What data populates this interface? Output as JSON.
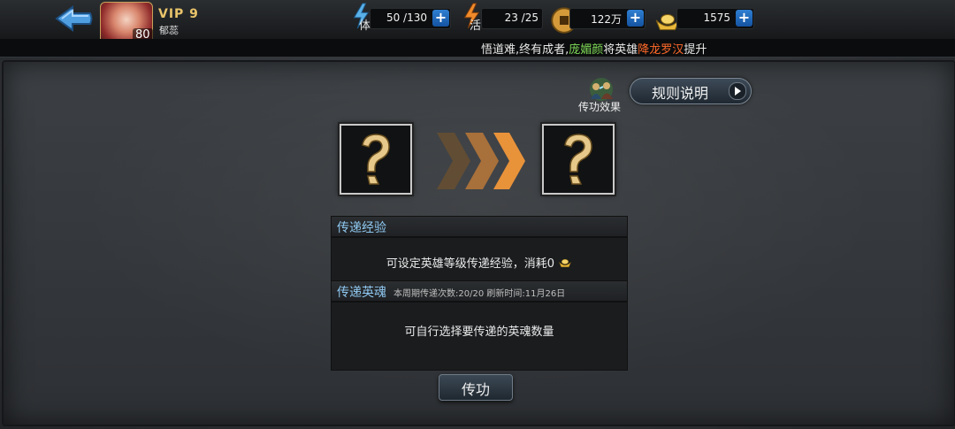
{
  "player": {
    "level": "80",
    "vip": "VIP 9",
    "name": "郁蕊"
  },
  "resources": {
    "stamina": {
      "icon": "stamina-icon",
      "label": "体",
      "value": "50 /130"
    },
    "energy": {
      "icon": "energy-icon",
      "label": "活",
      "value": "23 /25"
    },
    "coins": {
      "icon": "coin-icon",
      "value": "122万"
    },
    "ingots": {
      "icon": "ingot-icon",
      "value": "1575"
    }
  },
  "ticker": {
    "prefix": "悟道难,终有成者,",
    "name_green": "庞媚颜",
    "middle": "将英雄",
    "name_orange": "降龙罗汉",
    "suffix": "提升"
  },
  "rules_button": {
    "label": "规则说明"
  },
  "effect_label": "传功效果",
  "exp_section": {
    "title": "传递经验",
    "body": "可设定英雄等级传递经验，消耗0"
  },
  "soul_section": {
    "title": "传递英魂",
    "subtitle": "本周期传递次数:20/20 刷新时间:11月26日",
    "body": "可自行选择要传递的英魂数量"
  },
  "transfer_button": {
    "label": "传功"
  },
  "colors": {
    "accent_blue": "#8fc8f0",
    "gold": "#e9c46a",
    "ticker_green": "#7ed957",
    "ticker_orange": "#ff6a2a"
  }
}
